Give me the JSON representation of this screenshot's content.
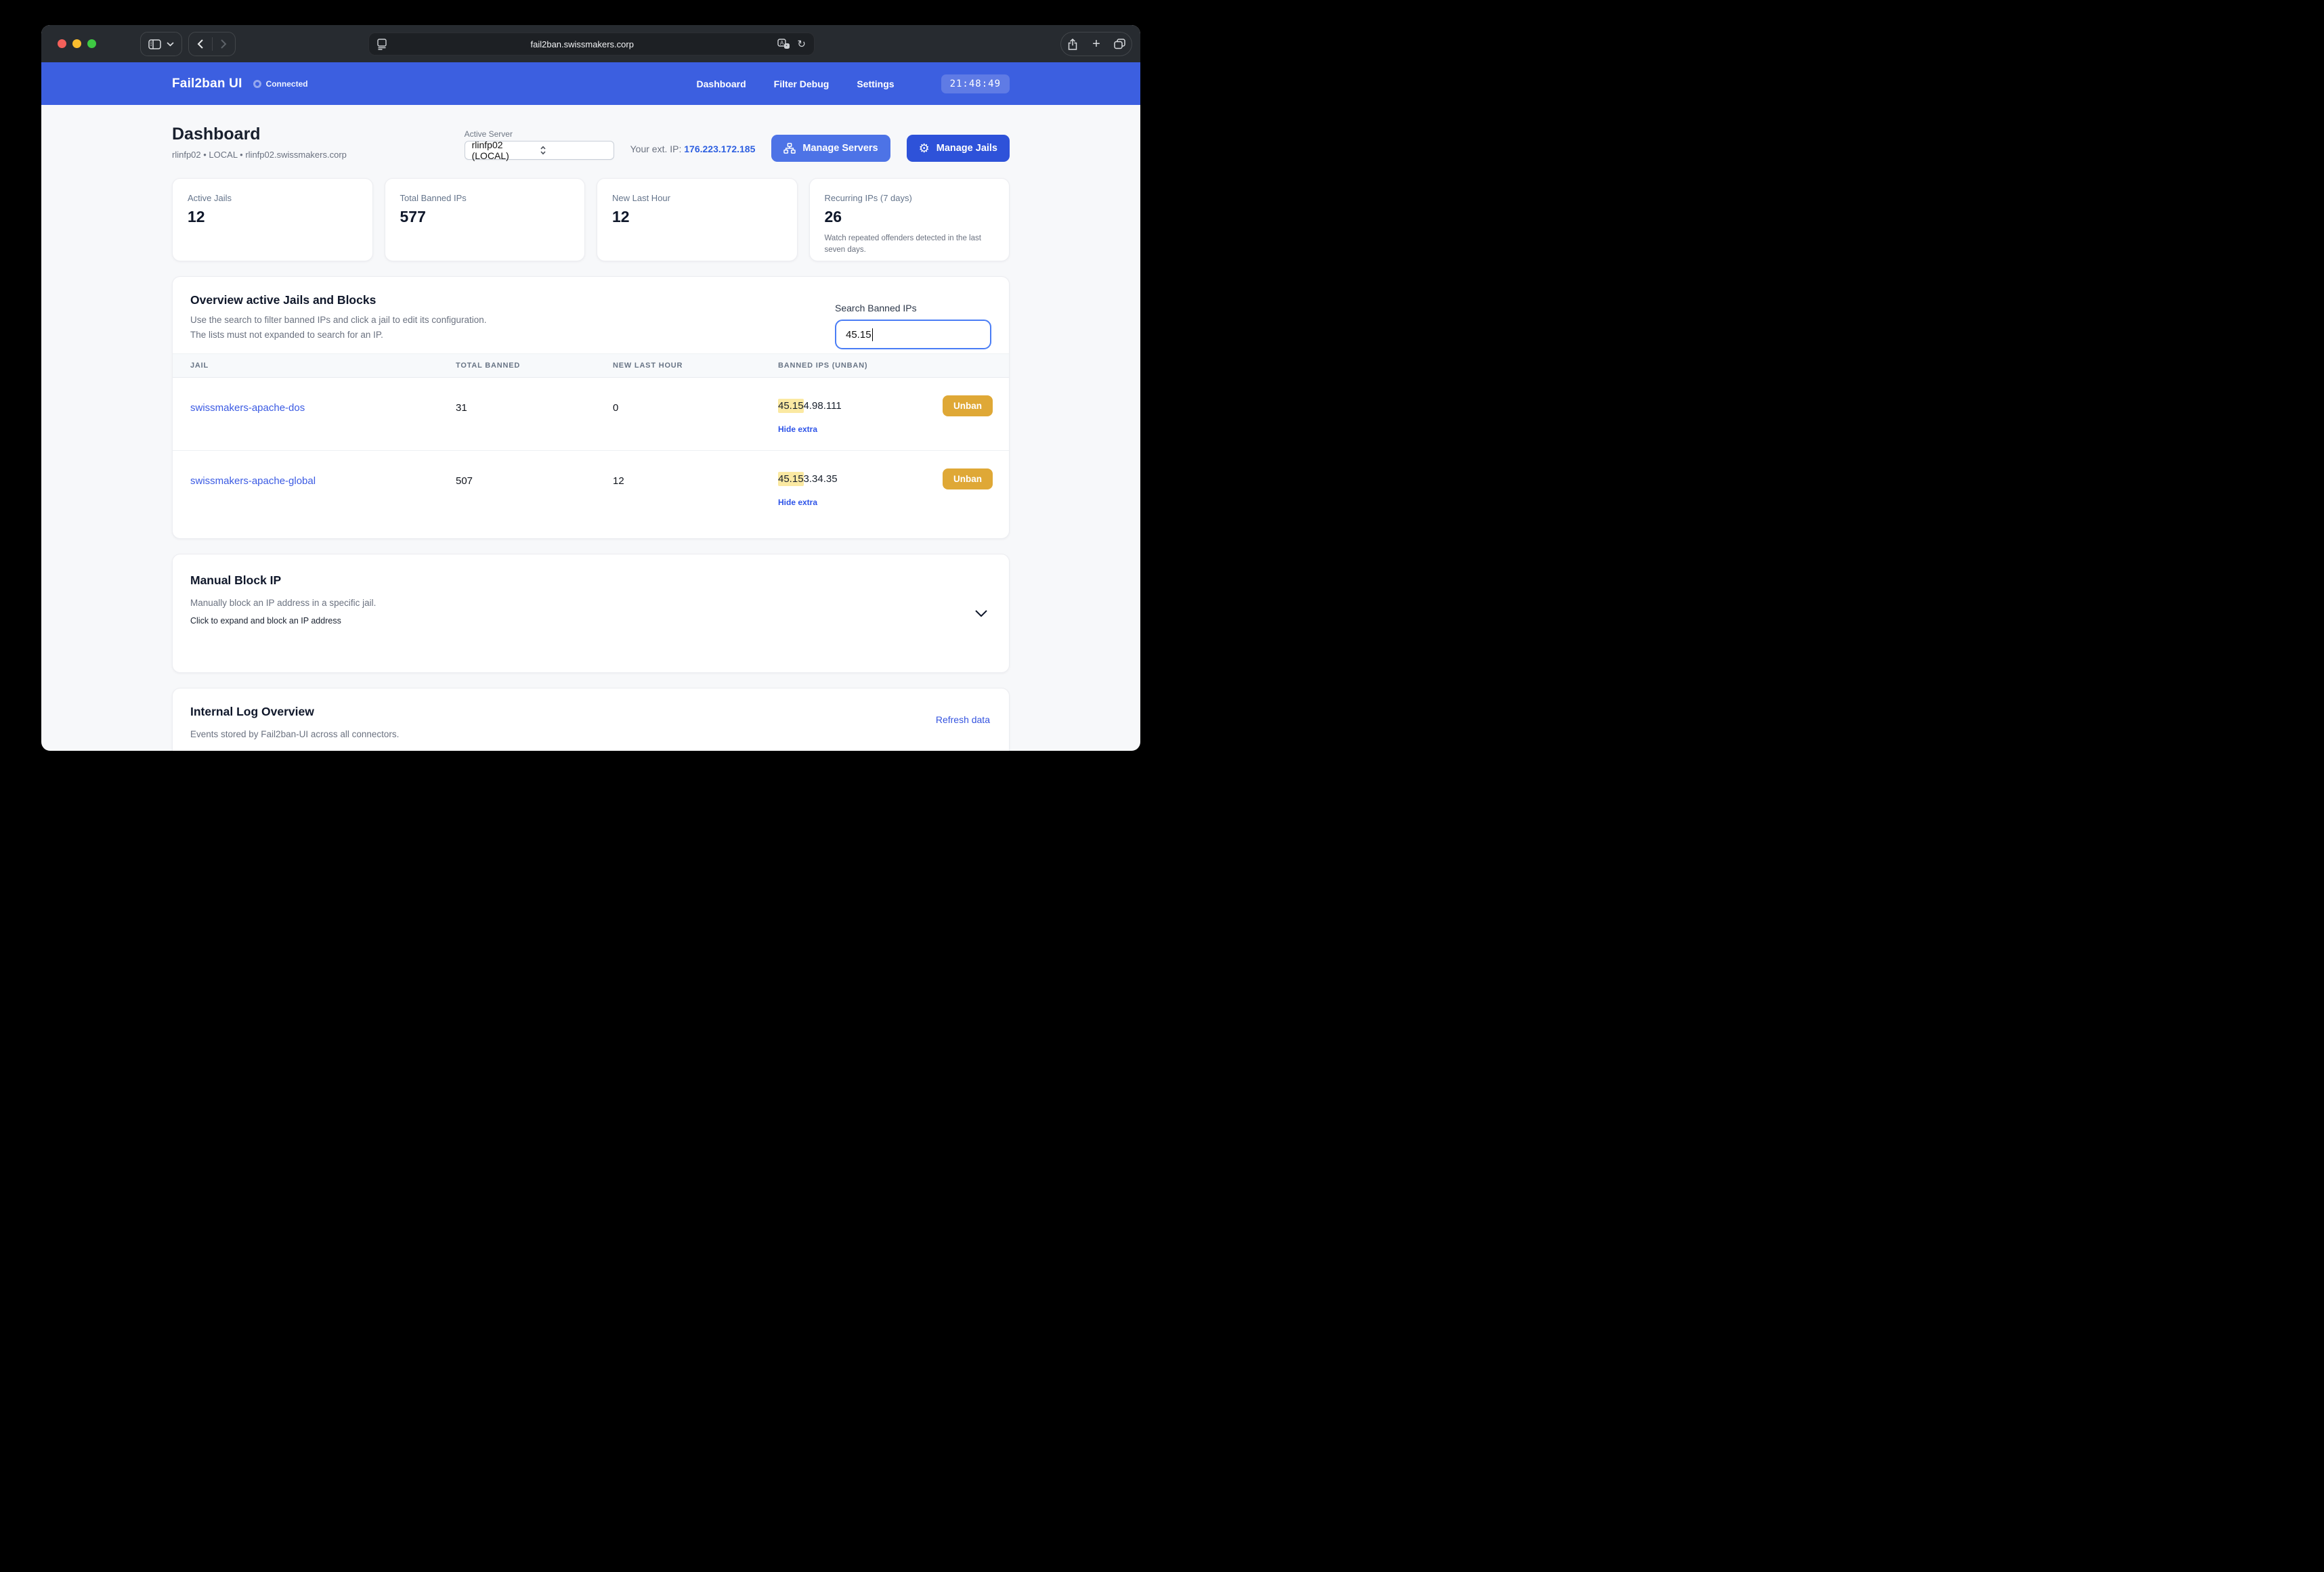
{
  "colors": {
    "nav-blue": "#3c5fe0",
    "btn-light-blue": "#4d73e6",
    "btn-dark-blue": "#2e52d9",
    "link-blue": "#3554e0",
    "amber": "#dfa836",
    "highlight": "#fbe9a2",
    "focus-ring": "#4a7df5"
  },
  "browser": {
    "url": "fail2ban.swissmakers.corp",
    "icons": {
      "new_tab": "+",
      "reload": "↻"
    }
  },
  "nav": {
    "brand": "Fail2ban UI",
    "status": "Connected",
    "links": [
      {
        "label": "Dashboard"
      },
      {
        "label": "Filter Debug"
      },
      {
        "label": "Settings"
      }
    ],
    "clock": "21:48:49"
  },
  "page": {
    "title": "Dashboard",
    "subtitle": "rlinfp02 • LOCAL • rlinfp02.swissmakers.corp",
    "active_server": {
      "label": "Active Server",
      "value": "rlinfp02 (LOCAL)"
    },
    "ext_ip": {
      "label": "Your ext. IP:",
      "value": "176.223.172.185"
    },
    "buttons": {
      "manage_servers": "Manage Servers",
      "manage_jails": "Manage Jails",
      "gear_glyph": "⚙"
    }
  },
  "stats": [
    {
      "label": "Active Jails",
      "value": "12"
    },
    {
      "label": "Total Banned IPs",
      "value": "577"
    },
    {
      "label": "New Last Hour",
      "value": "12"
    },
    {
      "label": "Recurring IPs (7 days)",
      "value": "26",
      "note": "Watch repeated offenders detected in the last seven days."
    }
  ],
  "overview": {
    "title": "Overview active Jails and Blocks",
    "desc1": "Use the search to filter banned IPs and click a jail to edit its configuration.",
    "desc2": "The lists must not expanded to search for an IP.",
    "search_label": "Search Banned IPs",
    "search_value": "45.15",
    "columns": [
      "Jail",
      "Total Banned",
      "New Last Hour",
      "Banned IPs (Unban)"
    ],
    "rows": [
      {
        "jail": "swissmakers-apache-dos",
        "total": "31",
        "new_hour": "0",
        "ip_highlight": "45.15",
        "ip_rest": "4.98.111",
        "unban": "Unban",
        "hide": "Hide extra"
      },
      {
        "jail": "swissmakers-apache-global",
        "total": "507",
        "new_hour": "12",
        "ip_highlight": "45.15",
        "ip_rest": "3.34.35",
        "unban": "Unban",
        "hide": "Hide extra"
      }
    ]
  },
  "manual_block": {
    "title": "Manual Block IP",
    "desc": "Manually block an IP address in a specific jail.",
    "note": "Click to expand and block an IP address"
  },
  "log": {
    "title": "Internal Log Overview",
    "desc": "Events stored by Fail2ban-UI across all connectors.",
    "refresh": "Refresh data"
  }
}
